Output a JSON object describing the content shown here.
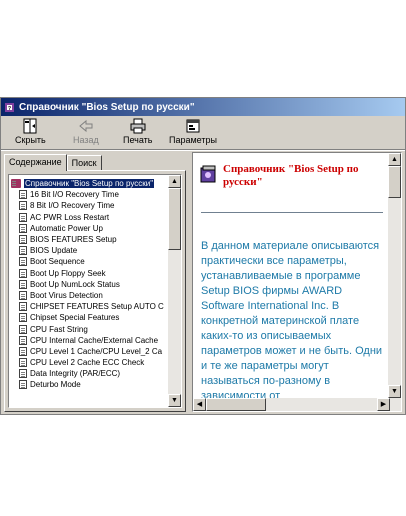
{
  "window": {
    "title": "Справочник \"Bios Setup по русски\""
  },
  "toolbar": {
    "hide_label": "Скрыть",
    "back_label": "Назад",
    "print_label": "Печать",
    "options_label": "Параметры"
  },
  "tabs": {
    "contents": "Содержание",
    "search": "Поиск"
  },
  "tree": {
    "items": [
      "Справочник \"Bios Setup по русски\"",
      "16 Bit I/O Recovery Time",
      "8 Bit I/O Recovery Time",
      "AC PWR Loss Restart",
      "Automatic Power Up",
      "BIOS FEATURES Setup",
      "BIOS Update",
      "Boot Sequence",
      "Boot Up Floppy Seek",
      "Boot Up NumLock Status",
      "Boot Virus Detection",
      "CHIPSET FEATURES Setup AUTO C",
      "Chipset Special Features",
      "CPU Fast String",
      "CPU Internal Cache/External Cache",
      "CPU Level 1 Cache/CPU Level_2 Ca",
      "CPU Level 2 Cache ECC Check",
      "Data Integrity (PAR/ECC)",
      "Deturbo Mode"
    ]
  },
  "content": {
    "title": "Справочник \"Bios Setup по русски\"",
    "body": "В данном материале описываются практически все параметры, устанавливаемые в программе Setup BIOS фирмы AWARD Software International Inc. В конкретной материнской плате каких-то из описываемых параметров может и не быть. Одни и те же параметры могут называться по-разному в зависимости от"
  },
  "colors": {
    "title_red": "#cc0000",
    "body_blue": "#1e7aa8",
    "titlebar": "#0a246a"
  }
}
